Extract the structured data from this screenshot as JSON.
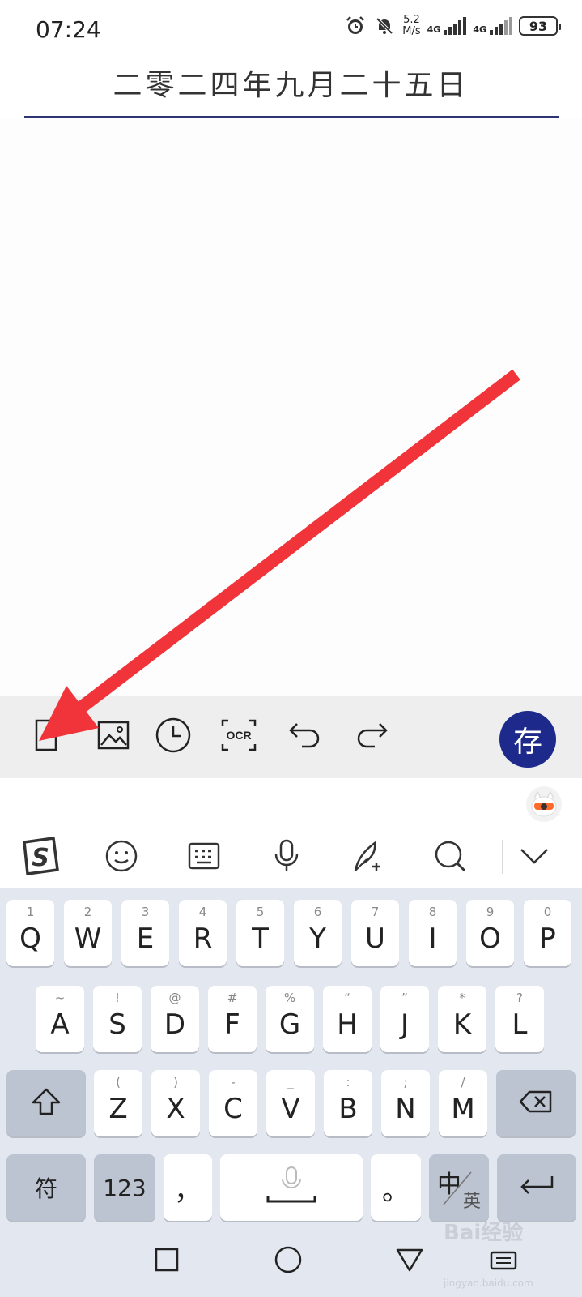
{
  "status_bar": {
    "time": "07:24",
    "speed_value": "5.2",
    "speed_unit": "M/s",
    "net1": "4G",
    "net2": "4G",
    "battery": "93"
  },
  "note": {
    "title": "二零二四年九月二十五日"
  },
  "editor_toolbar": {
    "items": [
      {
        "icon": "file-edit-icon"
      },
      {
        "icon": "image-icon"
      },
      {
        "icon": "clock-icon"
      },
      {
        "icon": "ocr-icon",
        "label": "OCR"
      },
      {
        "icon": "undo-icon"
      },
      {
        "icon": "redo-icon"
      }
    ],
    "save_label": "存",
    "save_color": "#1d2a8c"
  },
  "annotation": {
    "arrow_color": "#f0343a"
  },
  "keyboard_toolbar": {
    "items": [
      "sogou-logo-icon",
      "emoji-icon",
      "keyboard-icon",
      "microphone-icon",
      "handwriting-icon",
      "search-icon",
      "chevron-down-icon"
    ]
  },
  "keyboard": {
    "row1": [
      {
        "k": "Q",
        "h": "1"
      },
      {
        "k": "W",
        "h": "2"
      },
      {
        "k": "E",
        "h": "3"
      },
      {
        "k": "R",
        "h": "4"
      },
      {
        "k": "T",
        "h": "5"
      },
      {
        "k": "Y",
        "h": "6"
      },
      {
        "k": "U",
        "h": "7"
      },
      {
        "k": "I",
        "h": "8"
      },
      {
        "k": "O",
        "h": "9"
      },
      {
        "k": "P",
        "h": "0"
      }
    ],
    "row2": [
      {
        "k": "A",
        "h": "~"
      },
      {
        "k": "S",
        "h": "!"
      },
      {
        "k": "D",
        "h": "@"
      },
      {
        "k": "F",
        "h": "#"
      },
      {
        "k": "G",
        "h": "%"
      },
      {
        "k": "H",
        "h": "“"
      },
      {
        "k": "J",
        "h": "”"
      },
      {
        "k": "K",
        "h": "*"
      },
      {
        "k": "L",
        "h": "?"
      }
    ],
    "row3": [
      {
        "k": "Z",
        "h": "("
      },
      {
        "k": "X",
        "h": ")"
      },
      {
        "k": "C",
        "h": "-"
      },
      {
        "k": "V",
        "h": "_"
      },
      {
        "k": "B",
        "h": ":"
      },
      {
        "k": "N",
        "h": ";"
      },
      {
        "k": "M",
        "h": "/"
      }
    ],
    "symbol_key": "符",
    "num_key": "123",
    "comma_key": "，",
    "period_key": "。",
    "lang_key_main": "中",
    "lang_key_sub": "英"
  },
  "watermark": {
    "text": "Bai经验",
    "sub": "jingyan.baidu.com"
  }
}
